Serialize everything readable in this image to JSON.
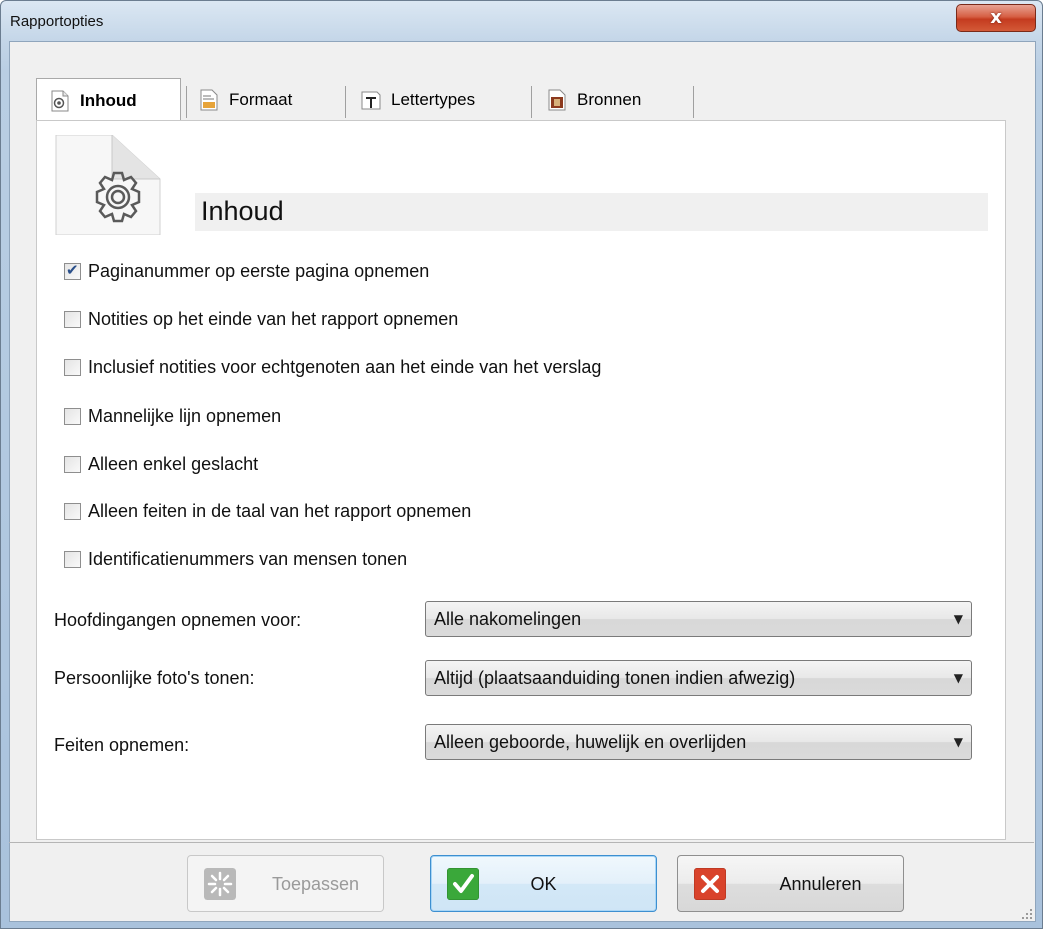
{
  "window": {
    "title": "Rapportopties",
    "close_glyph": "x"
  },
  "tabs": [
    {
      "label": "Inhoud",
      "icon": "gear-document-icon",
      "active": true
    },
    {
      "label": "Formaat",
      "icon": "format-document-icon",
      "active": false
    },
    {
      "label": "Lettertypes",
      "icon": "font-t-icon",
      "active": false
    },
    {
      "label": "Bronnen",
      "icon": "archive-box-icon",
      "active": false
    }
  ],
  "section": {
    "title": "Inhoud",
    "icon": "gear-document-icon"
  },
  "checkboxes": [
    {
      "label": "Paginanummer op eerste pagina opnemen",
      "checked": true
    },
    {
      "label": "Notities op het einde van het rapport opnemen",
      "checked": false
    },
    {
      "label": "Inclusief notities voor echtgenoten aan het einde van het verslag",
      "checked": false
    },
    {
      "label": "Mannelijke lijn opnemen",
      "checked": false
    },
    {
      "label": "Alleen enkel geslacht",
      "checked": false
    },
    {
      "label": "Alleen feiten in de taal van het rapport opnemen",
      "checked": false
    },
    {
      "label": "Identificatienummers van mensen tonen",
      "checked": false
    }
  ],
  "fields": [
    {
      "label": "Hoofdingangen opnemen voor:",
      "value": "Alle nakomelingen"
    },
    {
      "label": "Persoonlijke foto's tonen:",
      "value": "Altijd (plaatsaanduiding tonen indien afwezig)"
    },
    {
      "label": "Feiten opnemen:",
      "value": "Alleen geboorde, huwelijk en overlijden"
    }
  ],
  "buttons": {
    "apply": {
      "label": "Toepassen",
      "enabled": false
    },
    "ok": {
      "label": "OK"
    },
    "cancel": {
      "label": "Annuleren"
    }
  },
  "colors": {
    "ok_green": "#3aa83a",
    "cancel_red": "#d9432b",
    "accent_blue": "#3d8fd0"
  }
}
